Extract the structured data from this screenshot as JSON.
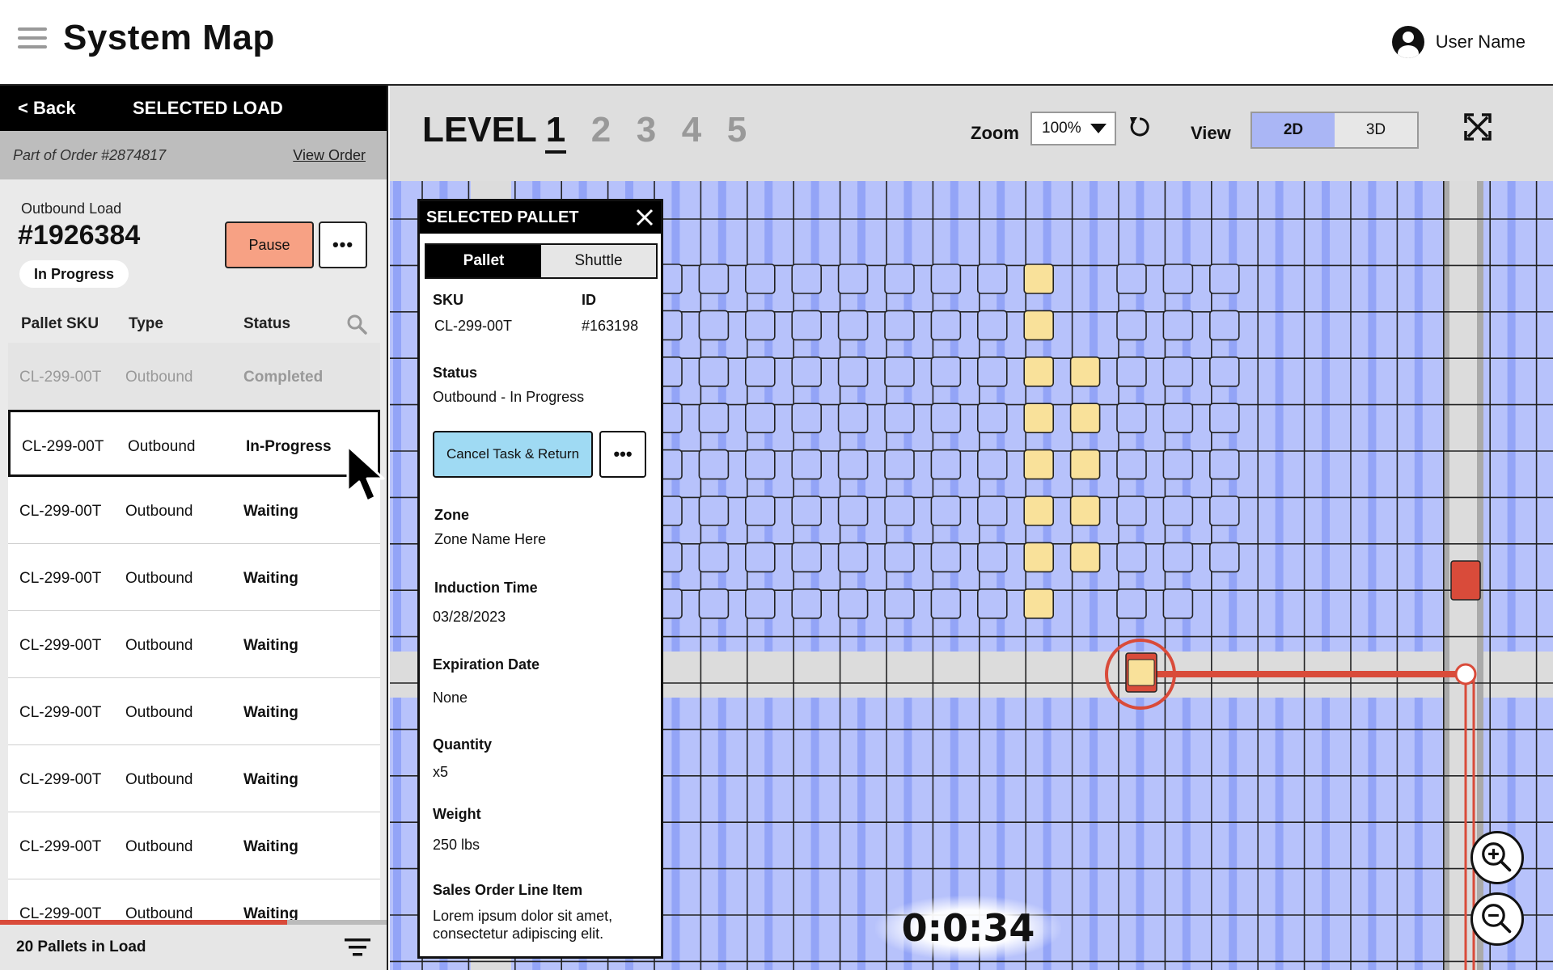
{
  "header": {
    "title": "System Map",
    "user_name": "User Name"
  },
  "left_panel": {
    "back_label": "< Back",
    "title": "SELECTED LOAD",
    "order_text": "Part of Order #2874817",
    "view_order": "View Order",
    "load_label": "Outbound Load",
    "load_number": "#1926384",
    "load_status": "In Progress",
    "pause_label": "Pause",
    "more_label": "•••",
    "columns": [
      "Pallet SKU",
      "Type",
      "Status"
    ],
    "rows": [
      {
        "sku": "CL-299-00T",
        "type": "Outbound",
        "status": "Completed"
      },
      {
        "sku": "CL-299-00T",
        "type": "Outbound",
        "status": "In-Progress"
      },
      {
        "sku": "CL-299-00T",
        "type": "Outbound",
        "status": "Waiting"
      },
      {
        "sku": "CL-299-00T",
        "type": "Outbound",
        "status": "Waiting"
      },
      {
        "sku": "CL-299-00T",
        "type": "Outbound",
        "status": "Waiting"
      },
      {
        "sku": "CL-299-00T",
        "type": "Outbound",
        "status": "Waiting"
      },
      {
        "sku": "CL-299-00T",
        "type": "Outbound",
        "status": "Waiting"
      },
      {
        "sku": "CL-299-00T",
        "type": "Outbound",
        "status": "Waiting"
      },
      {
        "sku": "CL-299-00T",
        "type": "Outbound",
        "status": "Waiting"
      }
    ],
    "footer": "20 Pallets in Load",
    "load_progress": 0.74
  },
  "map": {
    "level_label": "LEVEL",
    "levels": [
      "1",
      "2",
      "3",
      "4",
      "5"
    ],
    "active_level": "1",
    "zoom_label": "Zoom",
    "zoom_value": "100%",
    "view_label": "View",
    "view_2d": "2D",
    "view_3d": "3D",
    "timer": "0:0:34"
  },
  "pallet_popup": {
    "title": "SELECTED PALLET",
    "tab_pallet": "Pallet",
    "tab_shuttle": "Shuttle",
    "sku_label": "SKU",
    "sku_value": "CL-299-00T",
    "id_label": "ID",
    "id_value": "#163198",
    "status_label": "Status",
    "status_value": "Outbound - In Progress",
    "cancel_label": "Cancel Task & Return",
    "more_label": "•••",
    "zone_label": "Zone",
    "zone_value": "Zone Name Here",
    "induction_label": "Induction Time",
    "induction_value": "03/28/2023",
    "expiration_label": "Expiration Date",
    "expiration_value": "None",
    "quantity_label": "Quantity",
    "quantity_value": "x5",
    "weight_label": "Weight",
    "weight_value": "250 lbs",
    "sales_label": "Sales Order Line Item",
    "sales_value_1": "Lorem ipsum dolor sit amet,",
    "sales_value_2": "consectetur adipiscing elit."
  },
  "colors": {
    "lane": "#b7c2fb",
    "lane_stripe": "#93a4f7",
    "aisle": "#dcdcdc",
    "pallet_selected": "#f9e19a",
    "alert": "#d94b3a",
    "pause": "#f7a184",
    "cancel": "#9fdaf3"
  }
}
